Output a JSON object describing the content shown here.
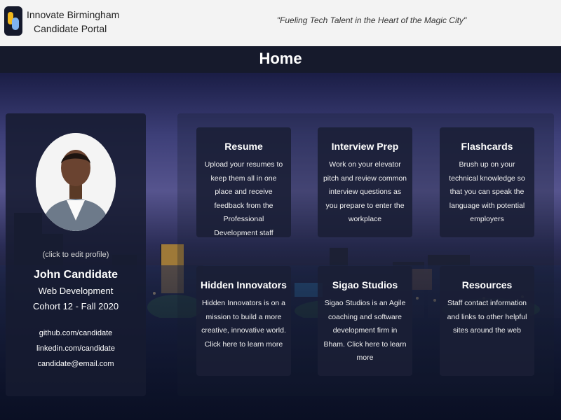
{
  "header": {
    "brand_line1": "Innovate Birmingham",
    "brand_line2": "Candidate Portal",
    "tagline": "\"Fueling Tech Talent in the Heart of the Magic City\""
  },
  "page_title": "Home",
  "profile": {
    "edit_hint": "(click to edit profile)",
    "name": "John Candidate",
    "track": "Web Development",
    "cohort": "Cohort 12 - Fall 2020",
    "github": "github.com/candidate",
    "linkedin": "linkedin.com/candidate",
    "email": "candidate@email.com"
  },
  "cards": [
    {
      "title": "Resume",
      "body": "Upload your resumes to keep them all in one place and receive feedback from the Professional Development staff"
    },
    {
      "title": "Interview Prep",
      "body": "Work on your elevator pitch and review common interview questions as you prepare to enter the workplace"
    },
    {
      "title": "Flashcards",
      "body": "Brush up on your technical knowledge so that you can speak the language with potential employers"
    },
    {
      "title": "Hidden Innovators",
      "body": "Hidden Innovators is on a mission to build a more creative, innovative world. Click here to learn more"
    },
    {
      "title": "Sigao Studios",
      "body": "Sigao Studios is an Agile coaching and software development firm in Bham. Click here to learn more"
    },
    {
      "title": "Resources",
      "body": "Staff contact information and links to other helpful sites around the web"
    }
  ],
  "colors": {
    "header_bg": "#f3f3f3",
    "titlebar_bg": "#161a2c",
    "panel_bg": "#161b30",
    "logo_yellow": "#f2b81c",
    "logo_blue": "#7fb2f0"
  }
}
